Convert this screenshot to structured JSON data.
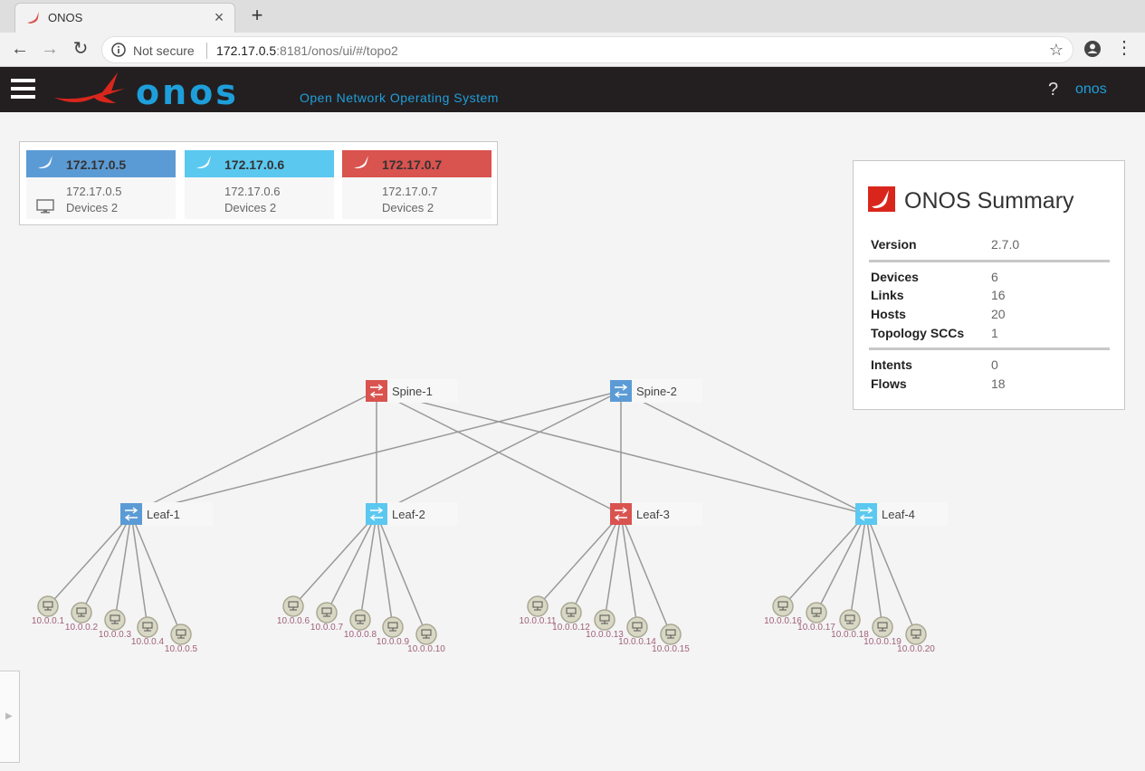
{
  "browser": {
    "tab_title": "ONOS",
    "tab_close": "×",
    "new_tab": "+",
    "security": "Not secure",
    "url_host": "172.17.0.5",
    "url_rest": ":8181/onos/ui/#/topo2",
    "back": "←",
    "forward": "→",
    "reload": "↻",
    "star": "☆",
    "menu": "⋮"
  },
  "masthead": {
    "logo_text": "onos",
    "subtitle": "Open Network Operating System",
    "help": "?",
    "user": "onos"
  },
  "cluster": {
    "nodes": [
      {
        "ip": "172.17.0.5",
        "detail_ip": "172.17.0.5",
        "devices": "Devices 2",
        "color": "#5b9bd5"
      },
      {
        "ip": "172.17.0.6",
        "detail_ip": "172.17.0.6",
        "devices": "Devices 2",
        "color": "#5bc8f0"
      },
      {
        "ip": "172.17.0.7",
        "detail_ip": "172.17.0.7",
        "devices": "Devices 2",
        "color": "#d9534f"
      }
    ]
  },
  "summary": {
    "title": "ONOS Summary",
    "rows": [
      {
        "label": "Version",
        "value": "2.7.0"
      },
      {
        "label": "Devices",
        "value": "6"
      },
      {
        "label": "Links",
        "value": "16"
      },
      {
        "label": "Hosts",
        "value": "20"
      },
      {
        "label": "Topology SCCs",
        "value": "1"
      },
      {
        "label": "Intents",
        "value": "0"
      },
      {
        "label": "Flows",
        "value": "18"
      }
    ]
  },
  "topology": {
    "devices": [
      {
        "id": "spine1",
        "label": "Spine-1",
        "color": "#d9534f"
      },
      {
        "id": "spine2",
        "label": "Spine-2",
        "color": "#5b9bd5"
      },
      {
        "id": "leaf1",
        "label": "Leaf-1",
        "color": "#5b9bd5"
      },
      {
        "id": "leaf2",
        "label": "Leaf-2",
        "color": "#5bc8f0"
      },
      {
        "id": "leaf3",
        "label": "Leaf-3",
        "color": "#d9534f"
      },
      {
        "id": "leaf4",
        "label": "Leaf-4",
        "color": "#5bc8f0"
      }
    ],
    "links": [
      [
        "spine1",
        "leaf1"
      ],
      [
        "spine1",
        "leaf2"
      ],
      [
        "spine1",
        "leaf3"
      ],
      [
        "spine1",
        "leaf4"
      ],
      [
        "spine2",
        "leaf1"
      ],
      [
        "spine2",
        "leaf2"
      ],
      [
        "spine2",
        "leaf3"
      ],
      [
        "spine2",
        "leaf4"
      ]
    ],
    "hosts": [
      {
        "label": "10.0.0.1",
        "leaf": "leaf1"
      },
      {
        "label": "10.0.0.2",
        "leaf": "leaf1"
      },
      {
        "label": "10.0.0.3",
        "leaf": "leaf1"
      },
      {
        "label": "10.0.0.4",
        "leaf": "leaf1"
      },
      {
        "label": "10.0.0.5",
        "leaf": "leaf1"
      },
      {
        "label": "10.0.0.6",
        "leaf": "leaf2"
      },
      {
        "label": "10.0.0.7",
        "leaf": "leaf2"
      },
      {
        "label": "10.0.0.8",
        "leaf": "leaf2"
      },
      {
        "label": "10.0.0.9",
        "leaf": "leaf2"
      },
      {
        "label": "10.0.0.10",
        "leaf": "leaf2"
      },
      {
        "label": "10.0.0.11",
        "leaf": "leaf3"
      },
      {
        "label": "10.0.0.12",
        "leaf": "leaf3"
      },
      {
        "label": "10.0.0.13",
        "leaf": "leaf3"
      },
      {
        "label": "10.0.0.14",
        "leaf": "leaf3"
      },
      {
        "label": "10.0.0.15",
        "leaf": "leaf3"
      },
      {
        "label": "10.0.0.16",
        "leaf": "leaf4"
      },
      {
        "label": "10.0.0.17",
        "leaf": "leaf4"
      },
      {
        "label": "10.0.0.18",
        "leaf": "leaf4"
      },
      {
        "label": "10.0.0.19",
        "leaf": "leaf4"
      },
      {
        "label": "10.0.0.20",
        "leaf": "leaf4"
      }
    ]
  }
}
